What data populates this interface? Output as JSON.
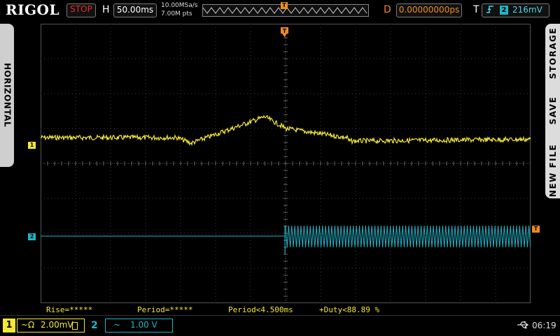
{
  "header": {
    "brand": "RIGOL",
    "run_state": "STOP",
    "timebase_label": "H",
    "timebase_value": "50.00ms",
    "sample_rate": "10.00MSa/s",
    "memory_depth": "7.00M pts",
    "trigger_pos_marker": "T",
    "delay_label": "D",
    "delay_value": "0.00000000ps",
    "trigger_label": "T",
    "trigger_edge_icon": "rising-edge-icon",
    "trigger_channel": "2",
    "trigger_level": "216mV"
  },
  "side_tabs": {
    "left": "HORIZONTAL",
    "right": [
      "STORAGE",
      "SAVE",
      "NEW FILE"
    ]
  },
  "markers": {
    "ch1": "1",
    "ch2": "2",
    "trigger_level": "T",
    "trigger_position": "T"
  },
  "measurements": [
    "Rise=*****",
    "Period=*****",
    "Period<4.500ms",
    "+Duty<88.89 %"
  ],
  "footer": {
    "ch1": {
      "num": "1",
      "coupling": "~Ω",
      "scale": "2.00mV"
    },
    "ch2": {
      "num": "2",
      "coupling": "~",
      "scale": "1.00 V"
    },
    "usb_icon": "usb-icon",
    "time": "06:19"
  },
  "colors": {
    "ch1": "#f3e736",
    "ch2": "#1fb5c8",
    "trigger": "#f08c1e",
    "stop": "#e03030"
  }
}
